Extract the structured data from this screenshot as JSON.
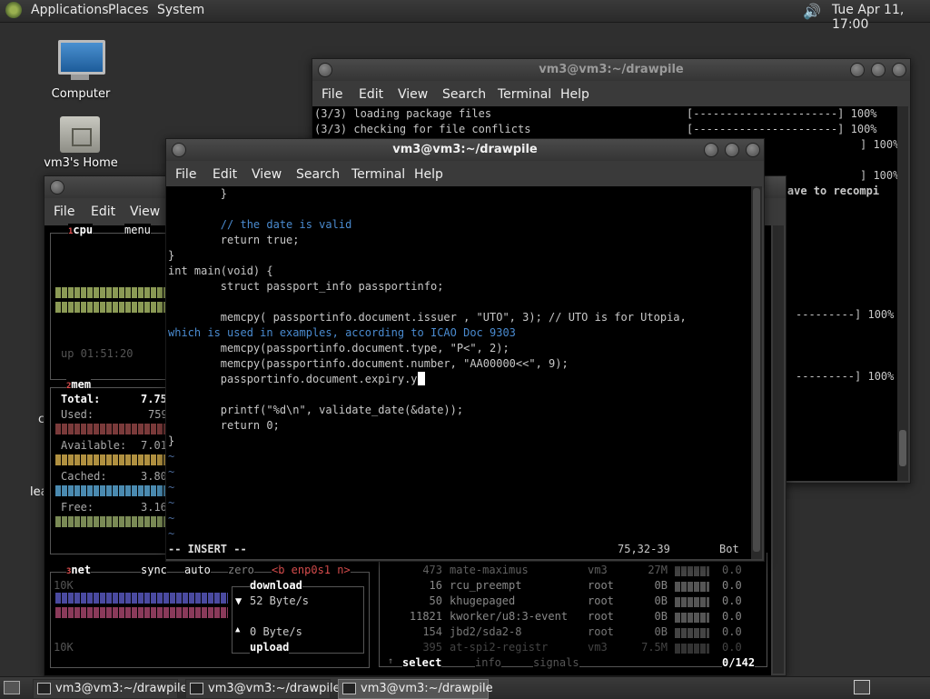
{
  "top_panel": {
    "menus": [
      "Applications",
      "Places",
      "System"
    ],
    "clock": "Tue Apr 11, 17:00"
  },
  "desktop": {
    "icons": [
      {
        "label": "Computer"
      },
      {
        "label": "vm3's Home"
      }
    ],
    "partial_labels": [
      "c",
      "lea"
    ]
  },
  "back_window": {
    "title": "vm3@vm3:~/drawpile",
    "menu": [
      "File",
      "Edit",
      "View",
      "Search",
      "Terminal",
      "Help"
    ],
    "lines": [
      {
        "left": "(3/3) loading package files",
        "right": "[----------------------] 100%"
      },
      {
        "left": "(3/3) checking for file conflicts",
        "right": "[----------------------] 100%"
      },
      {
        "left": "",
        "right": "] 100%"
      },
      {
        "left": "",
        "right": "] 100%"
      },
      {
        "left": "",
        "right": "ay have to recompi"
      },
      {
        "left": "",
        "right": "---------] 100%"
      },
      {
        "left": "",
        "right": "---------] 100%"
      }
    ]
  },
  "btop_window": {
    "menu": [
      "File",
      "Edit",
      "View"
    ],
    "cpu": {
      "title": "cpu",
      "menu": "menu",
      "uptime": "up 01:51:20",
      "superscript": "1"
    },
    "mem": {
      "title": "mem",
      "superscript": "2",
      "rows": [
        {
          "label": "Total:",
          "value": "7.75"
        },
        {
          "label": "Used:",
          "value": "759"
        },
        {
          "label": "Available:",
          "value": "7.01"
        },
        {
          "label": "Cached:",
          "value": "3.80"
        },
        {
          "label": "Free:",
          "value": "3.16"
        }
      ]
    },
    "net": {
      "title": "net",
      "superscript": "3",
      "sync": "sync",
      "auto": "auto",
      "zero": "zero",
      "iface": "<b enp0s1 n>",
      "scale_top": "10K",
      "scale_bottom": "10K",
      "download_label": "download",
      "download_rate": "52 Byte/s",
      "upload_rate": "0 Byte/s",
      "upload_label": "upload"
    },
    "proc": {
      "rows": [
        {
          "pid": "473",
          "name": "mate-maximus",
          "user": "vm3",
          "mem": "27M",
          "cpu": "0.0"
        },
        {
          "pid": "16",
          "name": "rcu_preempt",
          "user": "root",
          "mem": "0B",
          "cpu": "0.0"
        },
        {
          "pid": "50",
          "name": "khugepaged",
          "user": "root",
          "mem": "0B",
          "cpu": "0.0"
        },
        {
          "pid": "11821",
          "name": "kworker/u8:3-event",
          "user": "root",
          "mem": "0B",
          "cpu": "0.0"
        },
        {
          "pid": "154",
          "name": "jbd2/sda2-8",
          "user": "root",
          "mem": "0B",
          "cpu": "0.0"
        },
        {
          "pid": "395",
          "name": "at-spi2-registr",
          "user": "vm3",
          "mem": "7.5M",
          "cpu": "0.0"
        }
      ],
      "footer": {
        "select": "select",
        "info": "info",
        "signals": "signals",
        "count": "0/142"
      }
    }
  },
  "front_window": {
    "title": "vm3@vm3:~/drawpile",
    "menu": [
      "File",
      "Edit",
      "View",
      "Search",
      "Terminal",
      "Help"
    ],
    "code": [
      "        }",
      "",
      "        // the date is valid",
      "        return true;",
      "}",
      "int main(void) {",
      "        struct passport_info passportinfo;",
      "",
      "        memcpy( passportinfo.document.issuer , \"UTO\", 3); // UTO is for Utopia,",
      "which is used in examples, according to ICAO Doc 9303",
      "        memcpy(passportinfo.document.type, \"P<\", 2);",
      "        memcpy(passportinfo.document.number, \"AA00000<<\", 9);",
      "        passportinfo.document.expiry.y",
      "",
      "        printf(\"%d\\n\", validate_date(&date));",
      "        return 0;",
      "}"
    ],
    "tilde": "~",
    "status": {
      "mode": "-- INSERT --",
      "pos": "75,32-39",
      "where": "Bot"
    }
  },
  "taskbar": {
    "tasks": [
      {
        "label": "vm3@vm3:~/drawpile",
        "active": false
      },
      {
        "label": "vm3@vm3:~/drawpile",
        "active": false
      },
      {
        "label": "vm3@vm3:~/drawpile",
        "active": true
      }
    ]
  }
}
